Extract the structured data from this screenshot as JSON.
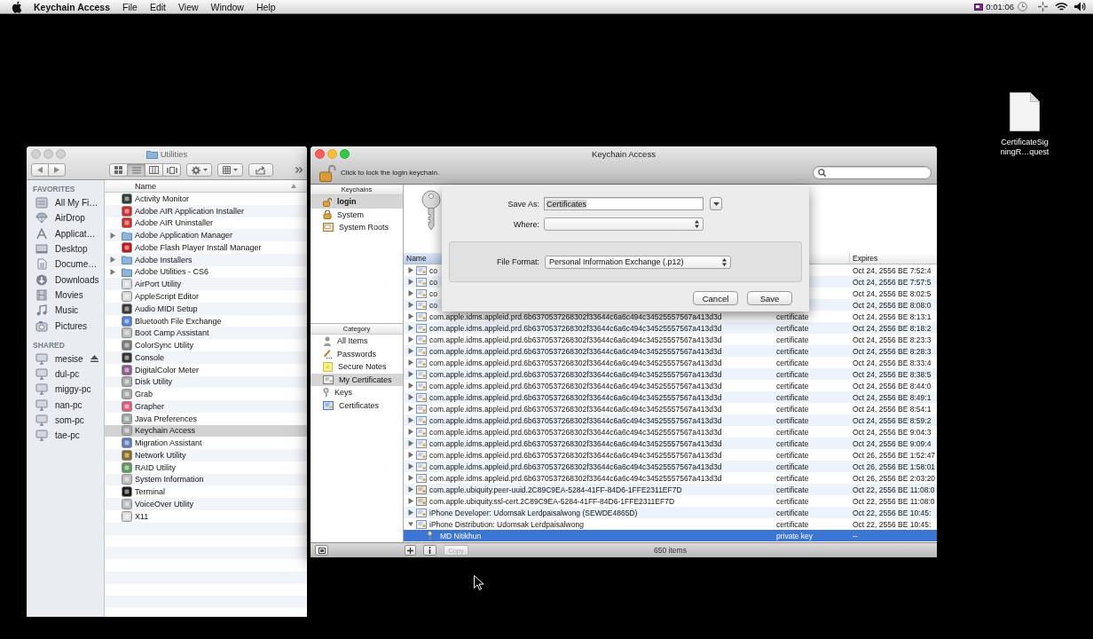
{
  "menu_bar": {
    "app_name": "Keychain Access",
    "menus": [
      "File",
      "Edit",
      "View",
      "Window",
      "Help"
    ],
    "timer": "0:01:06"
  },
  "desktop_icons": [
    {
      "label": "CertificateSigningR…quest"
    }
  ],
  "finder_window": {
    "title": "Utilities",
    "active": false,
    "view_buttons": [
      {
        "kind": "icons",
        "selected": false
      },
      {
        "kind": "list",
        "selected": true
      },
      {
        "kind": "columns",
        "selected": false
      },
      {
        "kind": "coverflow",
        "selected": false
      }
    ],
    "sidebar": [
      {
        "heading": "FAVORITES",
        "items": [
          {
            "label": "All My Fi…",
            "kind": "allfiles"
          },
          {
            "label": "AirDrop",
            "kind": "airdrop"
          },
          {
            "label": "Applicat…",
            "kind": "applications"
          },
          {
            "label": "Desktop",
            "kind": "desktop"
          },
          {
            "label": "Docume…",
            "kind": "documents"
          },
          {
            "label": "Downloads",
            "kind": "downloads"
          },
          {
            "label": "Movies",
            "kind": "movies"
          },
          {
            "label": "Music",
            "kind": "music"
          },
          {
            "label": "Pictures",
            "kind": "pictures"
          }
        ]
      },
      {
        "heading": "SHARED",
        "items": [
          {
            "label": "mesise",
            "kind": "computer",
            "eject": true
          },
          {
            "label": "dul-pc",
            "kind": "computer",
            "eject": false
          },
          {
            "label": "miggy-pc",
            "kind": "computer",
            "eject": false
          },
          {
            "label": "nan-pc",
            "kind": "computer",
            "eject": false
          },
          {
            "label": "som-pc",
            "kind": "computer",
            "eject": false
          },
          {
            "label": "tae-pc",
            "kind": "computer",
            "eject": false
          }
        ]
      }
    ],
    "list": {
      "column": {
        "label": "Name",
        "sorted": true
      },
      "rows": [
        {
          "name": "Activity Monitor",
          "kind": "app",
          "selected": false
        },
        {
          "name": "Adobe AIR Application Installer",
          "kind": "app",
          "selected": false
        },
        {
          "name": "Adobe AIR Uninstaller",
          "kind": "app",
          "selected": false
        },
        {
          "name": "Adobe Application Manager",
          "kind": "folder",
          "expanded": false,
          "selected": false
        },
        {
          "name": "Adobe Flash Player Install Manager",
          "kind": "app",
          "selected": false
        },
        {
          "name": "Adobe Installers",
          "kind": "folder",
          "expanded": false,
          "selected": false
        },
        {
          "name": "Adobe Utilities - CS6",
          "kind": "folder",
          "expanded": false,
          "selected": false
        },
        {
          "name": "AirPort Utility",
          "kind": "app",
          "selected": false
        },
        {
          "name": "AppleScript Editor",
          "kind": "app",
          "selected": false
        },
        {
          "name": "Audio MIDI Setup",
          "kind": "app",
          "selected": false
        },
        {
          "name": "Bluetooth File Exchange",
          "kind": "app",
          "selected": false
        },
        {
          "name": "Boot Camp Assistant",
          "kind": "app",
          "selected": false
        },
        {
          "name": "ColorSync Utility",
          "kind": "app",
          "selected": false
        },
        {
          "name": "Console",
          "kind": "app",
          "selected": false
        },
        {
          "name": "DigitalColor Meter",
          "kind": "app",
          "selected": false
        },
        {
          "name": "Disk Utility",
          "kind": "app",
          "selected": false
        },
        {
          "name": "Grab",
          "kind": "app",
          "selected": false
        },
        {
          "name": "Grapher",
          "kind": "app",
          "selected": false
        },
        {
          "name": "Java Preferences",
          "kind": "app",
          "selected": false
        },
        {
          "name": "Keychain Access",
          "kind": "app",
          "selected": true
        },
        {
          "name": "Migration Assistant",
          "kind": "app",
          "selected": false
        },
        {
          "name": "Network Utility",
          "kind": "app",
          "selected": false
        },
        {
          "name": "RAID Utility",
          "kind": "app",
          "selected": false
        },
        {
          "name": "System Information",
          "kind": "app",
          "selected": false
        },
        {
          "name": "Terminal",
          "kind": "app",
          "selected": false
        },
        {
          "name": "VoiceOver Utility",
          "kind": "app",
          "selected": false
        },
        {
          "name": "X11",
          "kind": "app",
          "selected": false
        }
      ]
    }
  },
  "keychain_window": {
    "title": "Keychain Access",
    "active": true,
    "lock_text": "Click to lock the login keychain.",
    "keychains": {
      "heading": "Keychains",
      "items": [
        {
          "label": "login",
          "kind": "login",
          "selected": true
        },
        {
          "label": "System",
          "kind": "system",
          "selected": false
        },
        {
          "label": "System Roots",
          "kind": "roots",
          "selected": false
        }
      ]
    },
    "category": {
      "heading": "Category",
      "items": [
        {
          "label": "All Items",
          "kind": "all",
          "selected": false
        },
        {
          "label": "Passwords",
          "kind": "passwords",
          "selected": false
        },
        {
          "label": "Secure Notes",
          "kind": "notes",
          "selected": false
        },
        {
          "label": "My Certificates",
          "kind": "mycerts",
          "selected": true
        },
        {
          "label": "Keys",
          "kind": "keys",
          "selected": false
        },
        {
          "label": "Certificates",
          "kind": "certs",
          "selected": false
        }
      ]
    },
    "table": {
      "columns": [
        {
          "label": "Name",
          "sorted": true
        },
        {
          "label": "Expires",
          "sorted": false
        }
      ],
      "rows": [
        {
          "name": "co",
          "expires": "Oct 24, 2556 BE 7:52:4",
          "kind": "cert",
          "expanded": false,
          "selected": false
        },
        {
          "name": "co",
          "expires": "Oct 24, 2556 BE 7:57:5",
          "kind": "cert",
          "expanded": false,
          "selected": false
        },
        {
          "name": "co",
          "expires": "Oct 24, 2556 BE 8:02:5",
          "kind": "cert",
          "expanded": false,
          "selected": false
        },
        {
          "name": "co",
          "expires": "Oct 24, 2556 BE 8:08:0",
          "kind": "cert",
          "expanded": false,
          "selected": false
        },
        {
          "name": "com.apple.idms.appleid.prd.6b6370537268302f33644c6a6c494c34525557567a413d3d",
          "column_2": "certificate",
          "expires": "Oct 24, 2556 BE 8:13:1",
          "kind": "cert",
          "expanded": false,
          "selected": false
        },
        {
          "name": "com.apple.idms.appleid.prd.6b6370537268302f33644c6a6c494c34525557567a413d3d",
          "column_2": "certificate",
          "expires": "Oct 24, 2556 BE 8:18:2",
          "kind": "cert",
          "expanded": false,
          "selected": false
        },
        {
          "name": "com.apple.idms.appleid.prd.6b6370537268302f33644c6a6c494c34525557567a413d3d",
          "column_2": "certificate",
          "expires": "Oct 24, 2556 BE 8:23:3",
          "kind": "cert",
          "expanded": false,
          "selected": false
        },
        {
          "name": "com.apple.idms.appleid.prd.6b6370537268302f33644c6a6c494c34525557567a413d3d",
          "column_2": "certificate",
          "expires": "Oct 24, 2556 BE 8:28:3",
          "kind": "cert",
          "expanded": false,
          "selected": false
        },
        {
          "name": "com.apple.idms.appleid.prd.6b6370537268302f33644c6a6c494c34525557567a413d3d",
          "column_2": "certificate",
          "expires": "Oct 24, 2556 BE 8:33:4",
          "kind": "cert",
          "expanded": false,
          "selected": false
        },
        {
          "name": "com.apple.idms.appleid.prd.6b6370537268302f33644c6a6c494c34525557567a413d3d",
          "column_2": "certificate",
          "expires": "Oct 24, 2556 BE 8:38:5",
          "kind": "cert",
          "expanded": false,
          "selected": false
        },
        {
          "name": "com.apple.idms.appleid.prd.6b6370537268302f33644c6a6c494c34525557567a413d3d",
          "column_2": "certificate",
          "expires": "Oct 24, 2556 BE 8:44:0",
          "kind": "cert",
          "expanded": false,
          "selected": false
        },
        {
          "name": "com.apple.idms.appleid.prd.6b6370537268302f33644c6a6c494c34525557567a413d3d",
          "column_2": "certificate",
          "expires": "Oct 24, 2556 BE 8:49:1",
          "kind": "cert",
          "expanded": false,
          "selected": false
        },
        {
          "name": "com.apple.idms.appleid.prd.6b6370537268302f33644c6a6c494c34525557567a413d3d",
          "column_2": "certificate",
          "expires": "Oct 24, 2556 BE 8:54:1",
          "kind": "cert",
          "expanded": false,
          "selected": false
        },
        {
          "name": "com.apple.idms.appleid.prd.6b6370537268302f33644c6a6c494c34525557567a413d3d",
          "column_2": "certificate",
          "expires": "Oct 24, 2556 BE 8:59:2",
          "kind": "cert",
          "expanded": false,
          "selected": false
        },
        {
          "name": "com.apple.idms.appleid.prd.6b6370537268302f33644c6a6c494c34525557567a413d3d",
          "column_2": "certificate",
          "expires": "Oct 24, 2556 BE 9:04:3",
          "kind": "cert",
          "expanded": false,
          "selected": false
        },
        {
          "name": "com.apple.idms.appleid.prd.6b6370537268302f33644c6a6c494c34525557567a413d3d",
          "column_2": "certificate",
          "expires": "Oct 24, 2556 BE 9:09:4",
          "kind": "cert",
          "expanded": false,
          "selected": false
        },
        {
          "name": "com.apple.idms.appleid.prd.6b6370537268302f33644c6a6c494c34525557567a413d3d",
          "column_2": "certificate",
          "expires": "Oct 26, 2556 BE 1:52:47",
          "kind": "cert",
          "expanded": false,
          "selected": false
        },
        {
          "name": "com.apple.idms.appleid.prd.6b6370537268302f33644c6a6c494c34525557567a413d3d",
          "column_2": "certificate",
          "expires": "Oct 26, 2556 BE 1:58:01",
          "kind": "cert",
          "expanded": false,
          "selected": false
        },
        {
          "name": "com.apple.idms.appleid.prd.6b6370537268302f33644c6a6c494c34525557567a413d3d",
          "column_2": "certificate",
          "expires": "Oct 26, 2556 BE 2:03:20",
          "kind": "cert",
          "expanded": false,
          "selected": false
        },
        {
          "name": "com.apple.ubiquity.peer-uuid.2C89C9EA-5284-41FF-84D6-1FFE2311EF7D",
          "column_2": "certificate",
          "expires": "Oct 22, 2556 BE 11:08:0",
          "kind": "graycert",
          "expanded": false,
          "selected": false
        },
        {
          "name": "com.apple.ubiquity.ssl-cert.2C89C9EA-5284-41FF-84D6-1FFE2311EF7D",
          "column_2": "certificate",
          "expires": "Oct 22, 2556 BE 11:08:0",
          "kind": "graycert",
          "expanded": false,
          "selected": false
        },
        {
          "name": "iPhone Developer: Udomsak Lerdpaisalwong (SEWDE4865D)",
          "column_2": "certificate",
          "expires": "Oct 22, 2556 BE 10:45:",
          "kind": "cert",
          "expanded": false,
          "selected": false
        },
        {
          "name": "iPhone Distribution: Udomsak Lerdpaisalwong",
          "column_2": "certificate",
          "expires": "Oct 22, 2556 BE 10:45:",
          "kind": "cert",
          "expanded": true,
          "selected": false,
          "children": [
            {
              "name": "MD Nitikhun",
              "column_2": "private key",
              "expires": "--",
              "kind": "key",
              "selected": true
            }
          ]
        }
      ]
    },
    "bottom_buttons": [
      {
        "kind": "add",
        "disabled": false
      },
      {
        "kind": "info",
        "disabled": false
      },
      {
        "kind": "text",
        "label": "Copy",
        "disabled": true
      }
    ],
    "status": "650 items",
    "save_sheet": {
      "save_as": {
        "label": "Save As:",
        "value": "Certificates",
        "value_selected": true
      },
      "where": {
        "label": "Where:"
      },
      "file_format": {
        "label": "File Format:",
        "value": "Personal Information Exchange (.p12)"
      },
      "buttons": [
        "Cancel",
        "Save"
      ]
    }
  }
}
